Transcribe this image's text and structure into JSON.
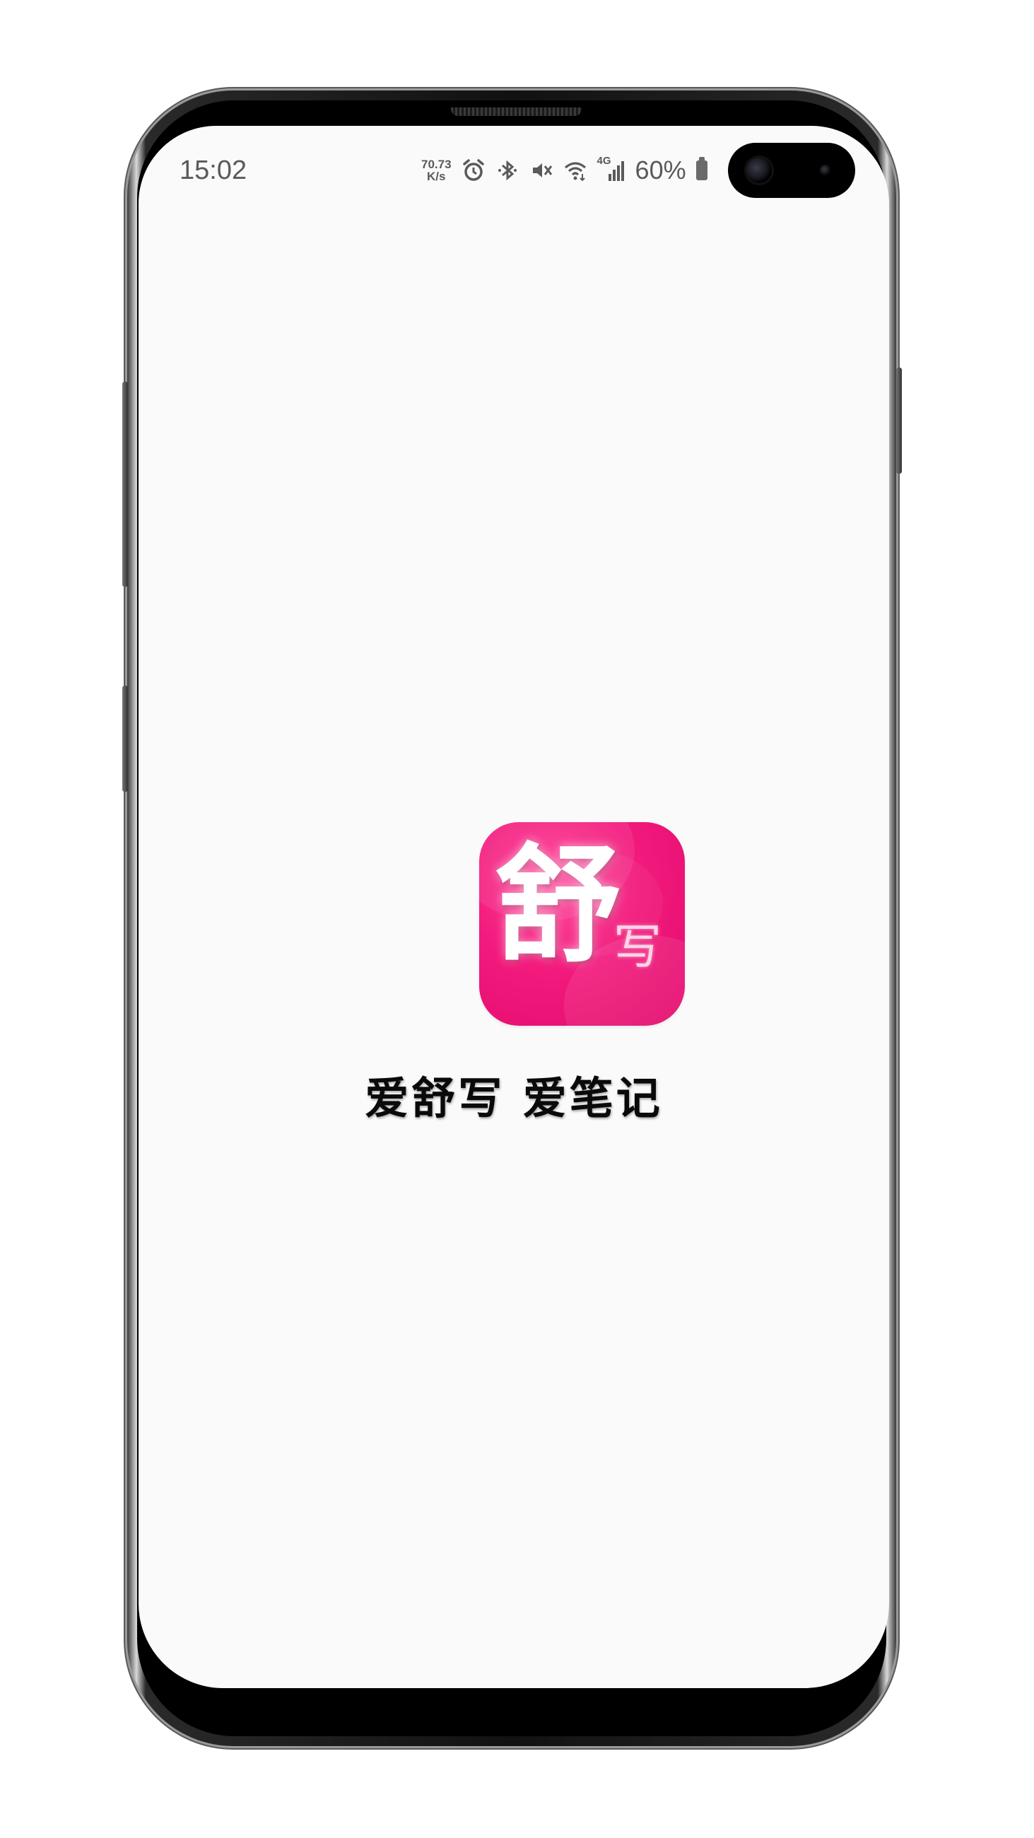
{
  "status_bar": {
    "time": "15:02",
    "net_speed_value": "70.73",
    "net_speed_unit": "K/s",
    "network_type": "4G",
    "battery_percent": "60%",
    "icons": [
      "alarm-icon",
      "bluetooth-icon",
      "mute-icon",
      "wifi-icon",
      "signal-icon",
      "battery-icon"
    ]
  },
  "splash": {
    "logo_main_char": "舒",
    "logo_sub_char": "写",
    "slogan": "爱舒写 爱笔记"
  },
  "colors": {
    "brand_pink": "#f21a7d",
    "screen_bg": "#fafafa",
    "status_text": "#5a5a5a"
  }
}
